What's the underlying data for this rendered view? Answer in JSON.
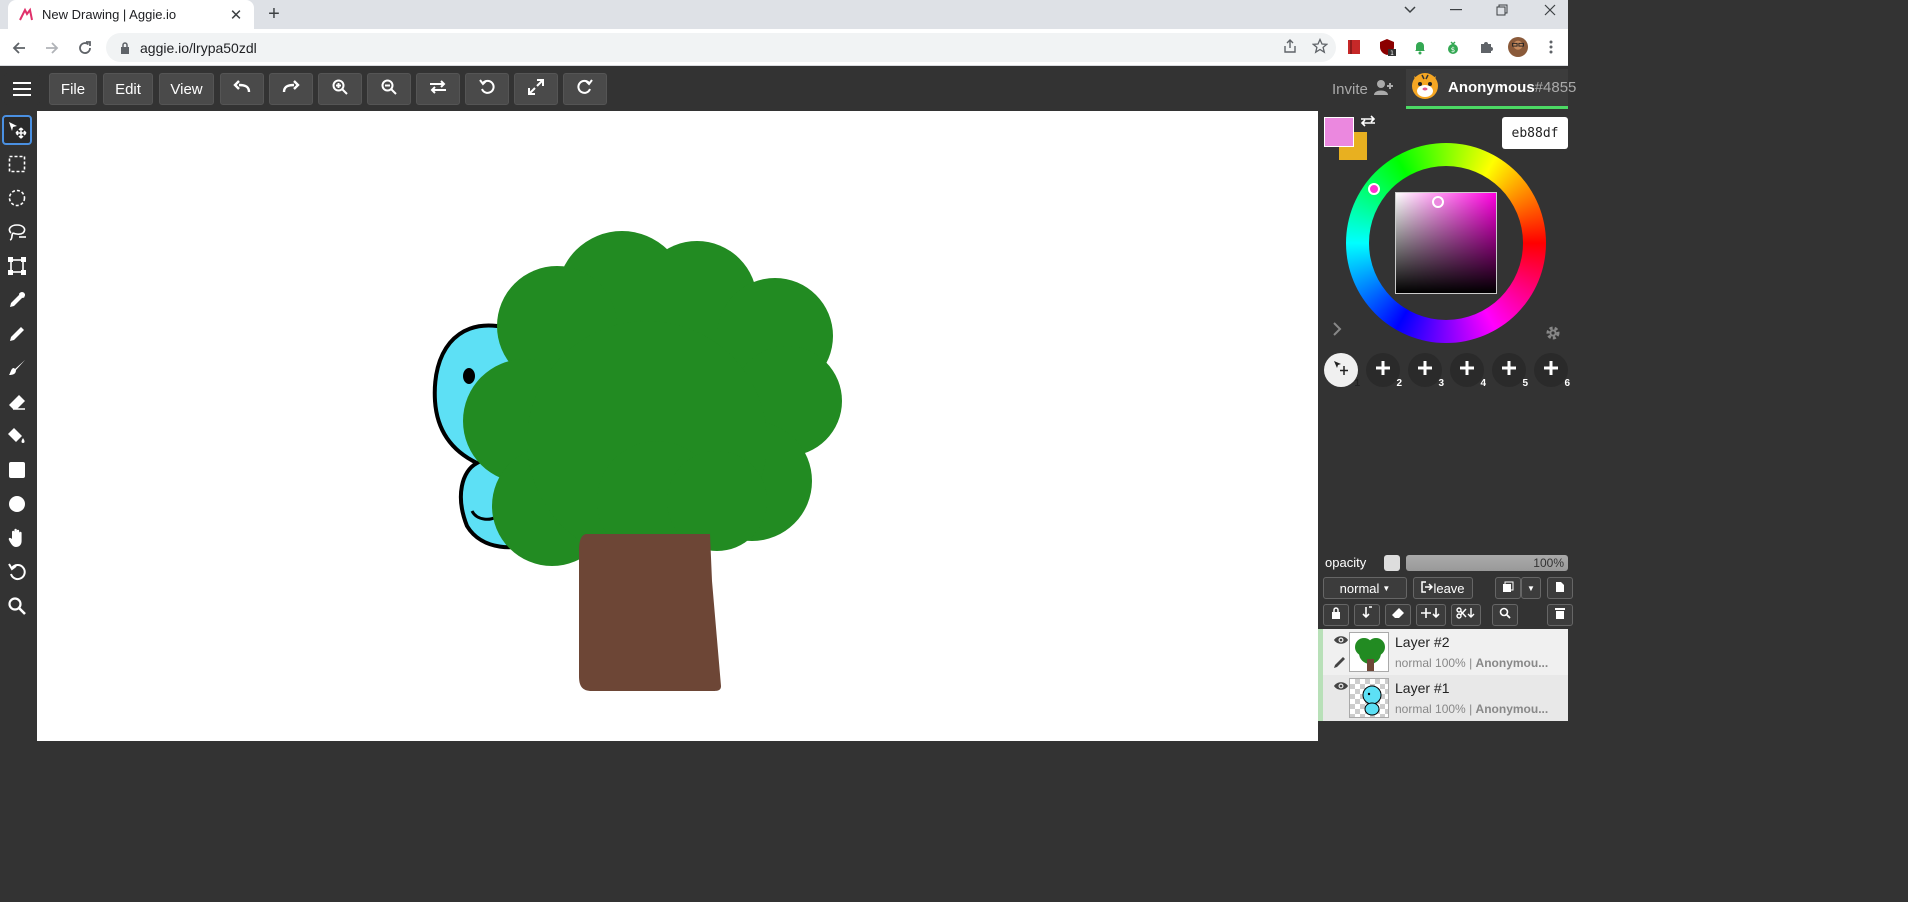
{
  "browser": {
    "tab_title": "New Drawing | Aggie.io",
    "url": "aggie.io/lrypa50zdl"
  },
  "toolbar": {
    "file_label": "File",
    "edit_label": "Edit",
    "view_label": "View",
    "invite_label": "Invite",
    "user_name": "Anonymous",
    "user_tag": "#4855"
  },
  "colors": {
    "primary": "#eb88df",
    "secondary": "#e8b020",
    "hex_value": "eb88df"
  },
  "brush_slots": [
    "1",
    "2",
    "3",
    "4",
    "5",
    "6"
  ],
  "layers_panel": {
    "opacity_label": "opacity",
    "opacity_value": "100%",
    "blend_mode": "normal",
    "leave_label": "leave"
  },
  "layers": [
    {
      "name": "Layer #2",
      "mode": "normal",
      "opacity": "100%",
      "owner": "Anonymou..."
    },
    {
      "name": "Layer #1",
      "mode": "normal",
      "opacity": "100%",
      "owner": "Anonymou..."
    }
  ]
}
